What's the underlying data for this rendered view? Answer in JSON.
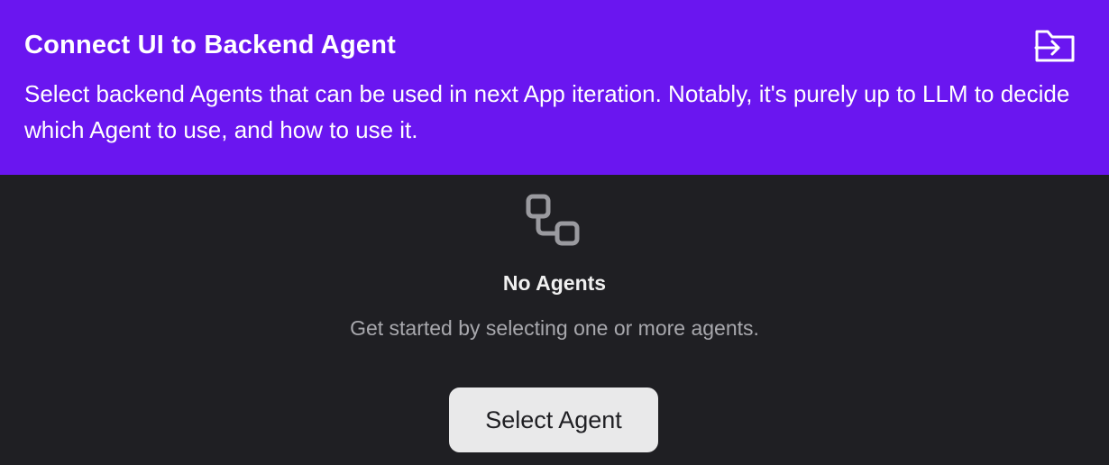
{
  "header": {
    "title": "Connect UI to Backend Agent",
    "description": "Select backend Agents that can be used in next App iteration. Notably, it's purely up to LLM to decide which Agent to use, and how to use it.",
    "action_icon": "folder-import-icon",
    "background_color": "#6a16f0"
  },
  "empty_state": {
    "icon": "workflow-nodes-icon",
    "title": "No Agents",
    "subtitle": "Get started by selecting one or more agents.",
    "button_label": "Select Agent"
  },
  "colors": {
    "background": "#1f1f23",
    "accent": "#6a16f0",
    "button_bg": "#e9e9ea"
  }
}
